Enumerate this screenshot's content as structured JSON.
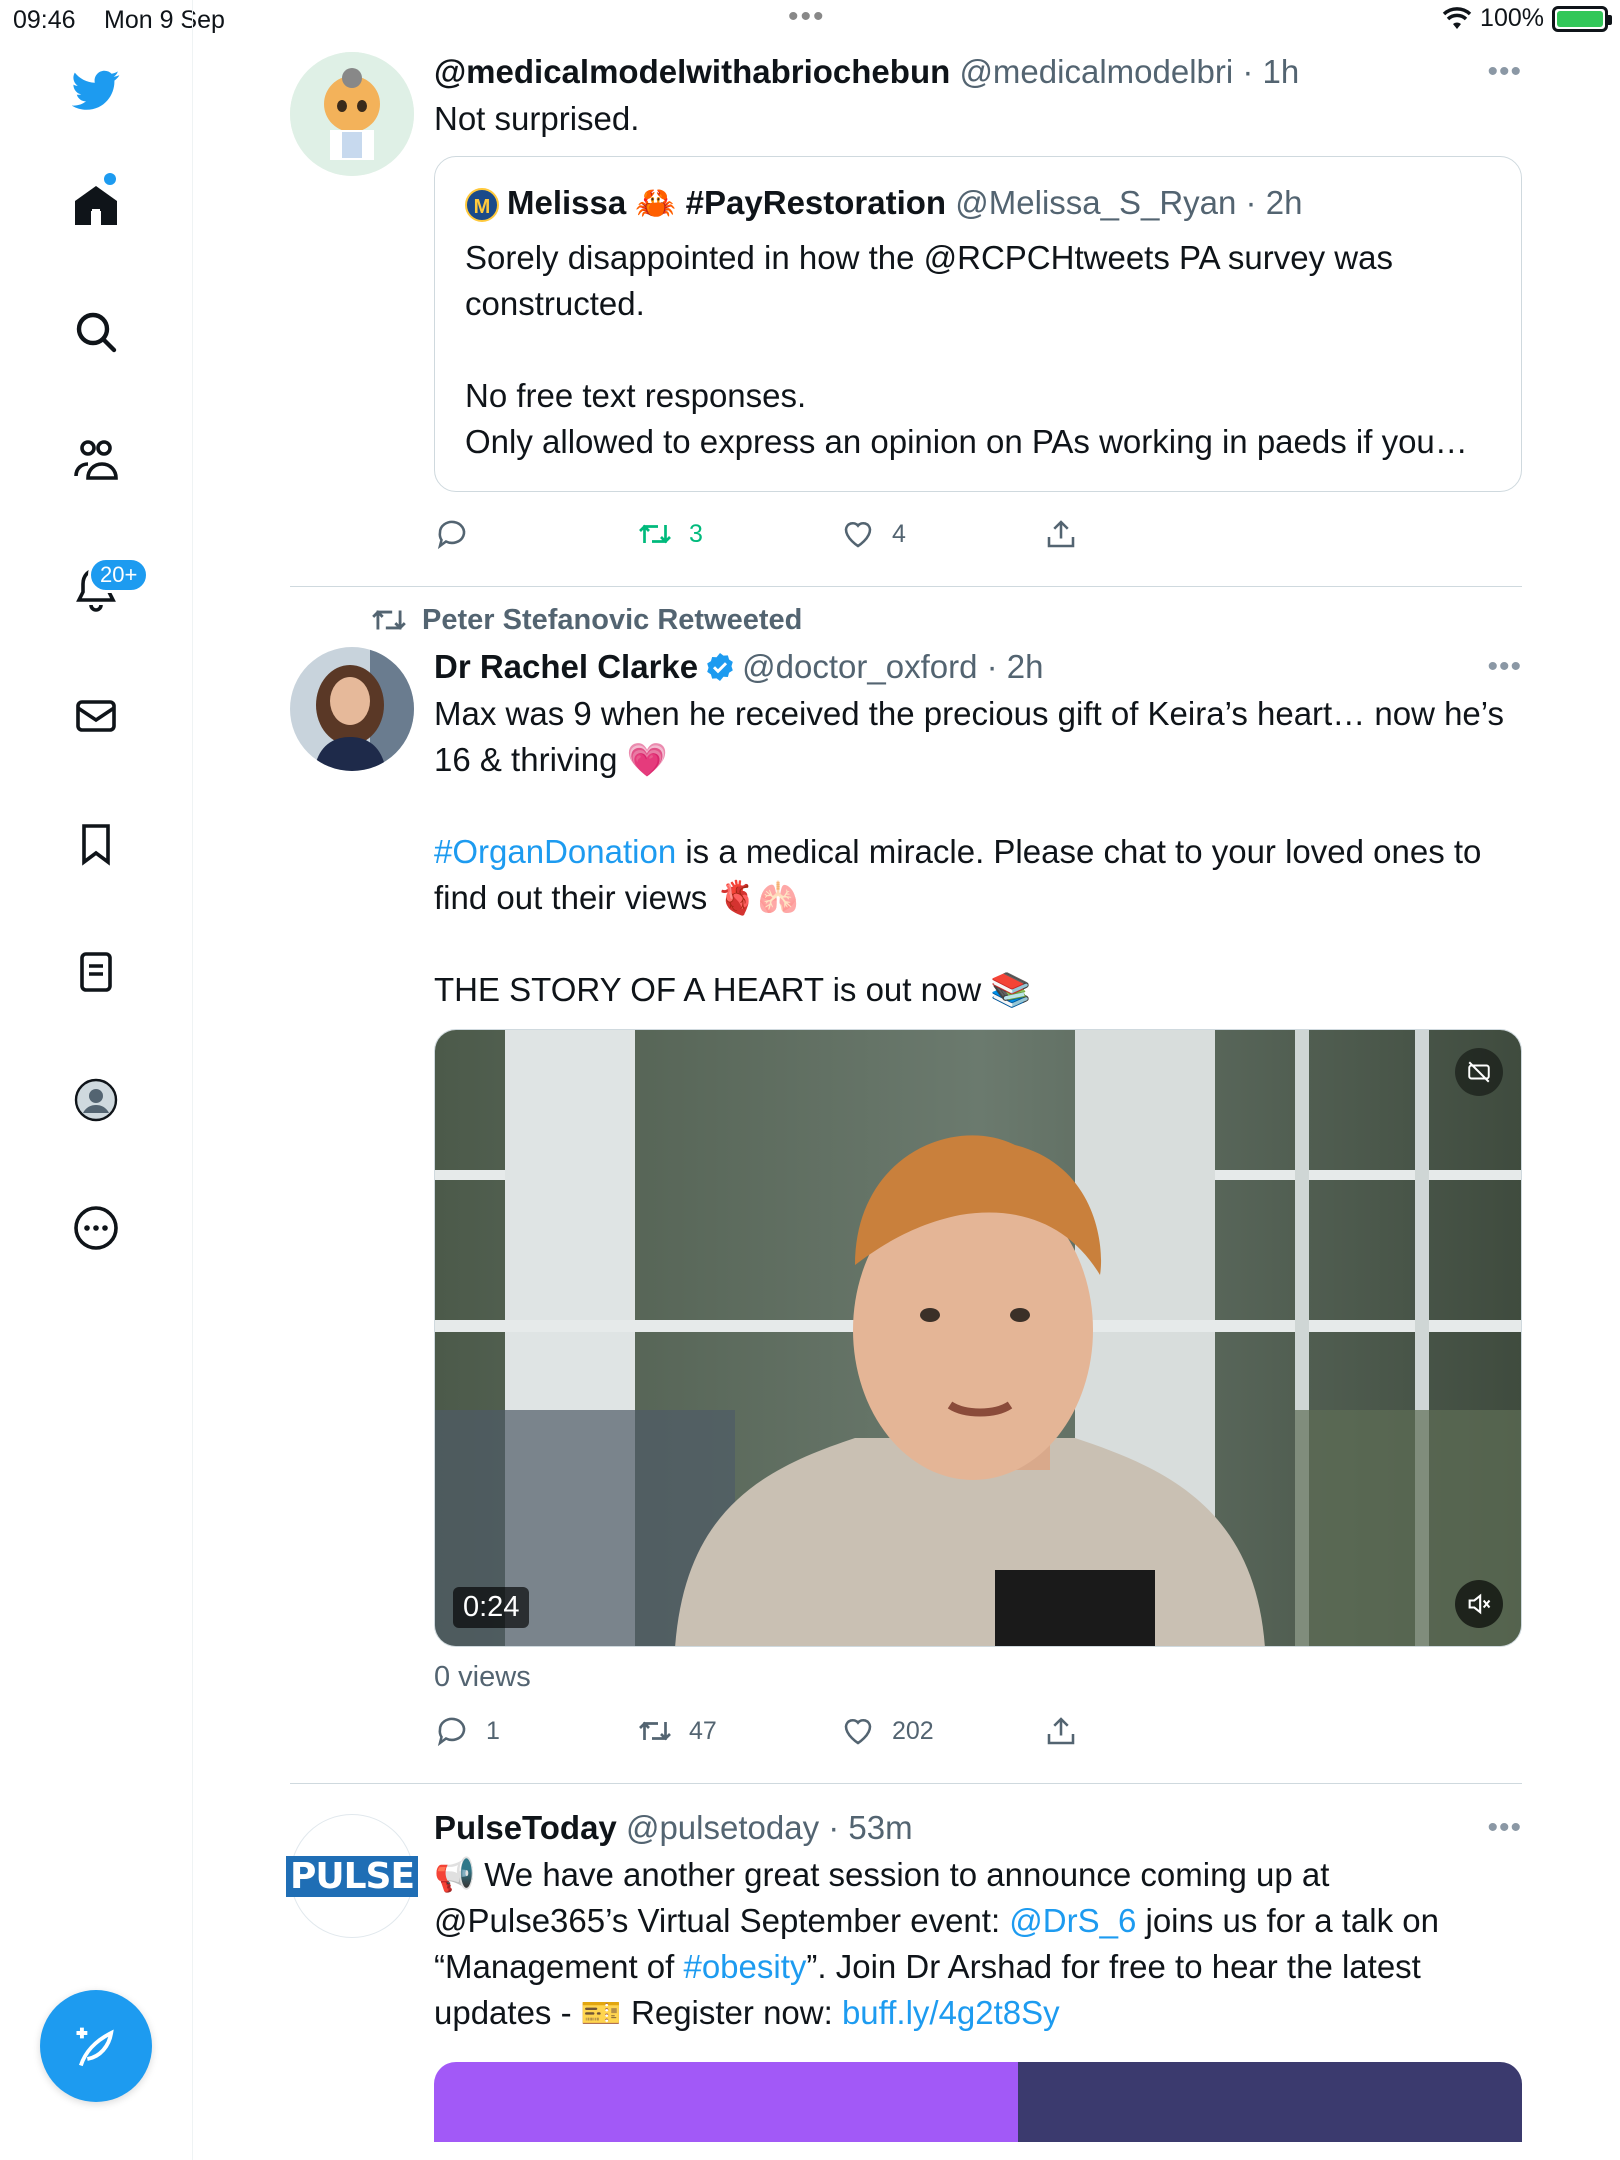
{
  "status_bar": {
    "time": "09:46",
    "date": "Mon 9 Sep",
    "battery": "100%"
  },
  "sidebar": {
    "notifications_badge": "20+"
  },
  "tweets": [
    {
      "display_name": "@medicalmodelwithabriochebun",
      "handle": "@medicalmodelbri",
      "time": "1h",
      "text": "Not surprised.",
      "quote": {
        "display_name": "Melissa 🦀 #PayRestoration",
        "avatar_letter": "M",
        "handle": "@Melissa_S_Ryan",
        "time": "2h",
        "text": "Sorely disappointed in how the @RCPCHtweets PA survey was constructed.\n\nNo free text responses.\nOnly allowed to express an opinion on PAs working in paeds if you…"
      },
      "replies": "",
      "retweets": "3",
      "likes": "4"
    },
    {
      "retweeted_by": "Peter Stefanovic Retweeted",
      "display_name": "Dr Rachel Clarke",
      "handle": "@doctor_oxford",
      "time": "2h",
      "text_1": "Max was 9 when he received the precious gift of Keira’s heart… now he’s 16 & thriving 💗",
      "hashtag": "#OrganDonation",
      "text_2": " is a medical miracle. Please chat to your loved ones to find out their views 🫀🫁",
      "text_3": "THE STORY OF A HEART is out now 📚",
      "video_duration": "0:24",
      "views": "0 views",
      "replies": "1",
      "retweets": "47",
      "likes": "202"
    },
    {
      "display_name": "PulseToday",
      "handle": "@pulsetoday",
      "time": "53m",
      "logo_text": "PULSE",
      "text_a": "📢 We have another great session to announce coming up at @Pulse365’s Virtual September event: ",
      "mention": "@DrS_6",
      "text_b": " joins us for a talk on “Management of ",
      "hashtag": "#obesity",
      "text_c": "”. Join Dr Arshad for free to hear the latest updates - 🎫 Register now: ",
      "link": "buff.ly/4g2t8Sy"
    }
  ],
  "colors": {
    "accent": "#1d9bf0",
    "retweet_green": "#00ba7c",
    "text_secondary": "#536471"
  }
}
